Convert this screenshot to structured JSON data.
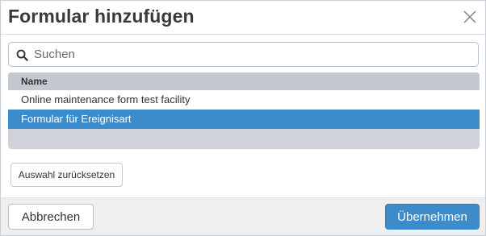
{
  "dialog": {
    "title": "Formular hinzufügen",
    "close_icon": "close-icon"
  },
  "search": {
    "placeholder": "Suchen",
    "value": "",
    "icon": "search-icon"
  },
  "table": {
    "header": "Name",
    "rows": [
      {
        "name": "Online maintenance form test facility",
        "selected": false
      },
      {
        "name": "Formular für Ereignisart",
        "selected": true
      }
    ]
  },
  "actions": {
    "reset_label": "Auswahl zurücksetzen",
    "cancel_label": "Abbrechen",
    "apply_label": "Übernehmen"
  },
  "colors": {
    "accent": "#3c8ccc",
    "table_header": "#c4c9d0",
    "footer_bg": "#efefef"
  }
}
